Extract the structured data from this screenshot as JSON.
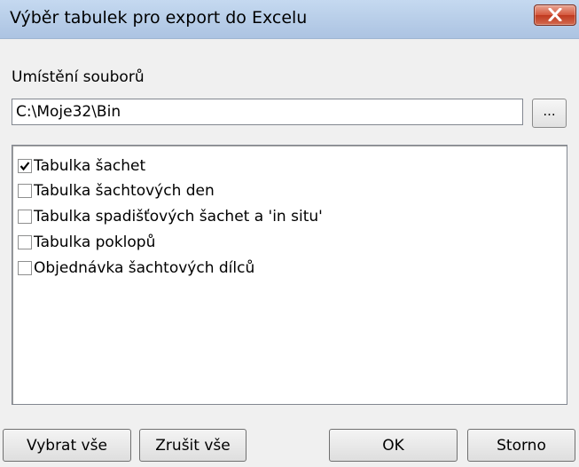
{
  "window": {
    "title": "Výběr tabulek pro export do Excelu"
  },
  "location": {
    "label": "Umístění souborů",
    "path_value": "C:\\Moje32\\Bin",
    "browse_label": "..."
  },
  "tables": {
    "items": [
      {
        "label": "Tabulka šachet",
        "checked": true
      },
      {
        "label": "Tabulka šachtových den",
        "checked": false
      },
      {
        "label": "Tabulka spadišťových šachet a 'in situ'",
        "checked": false
      },
      {
        "label": "Tabulka poklopů",
        "checked": false
      },
      {
        "label": "Objednávka šachtových dílců",
        "checked": false
      }
    ]
  },
  "buttons": {
    "select_all": "Vybrat vše",
    "clear_all": "Zrušit vše",
    "ok": "OK",
    "cancel": "Storno"
  },
  "icons": {
    "close": "close-icon",
    "checkmark": "checkmark-icon"
  },
  "colors": {
    "titlebar": "#b7cde8",
    "close_button": "#c0391f",
    "background": "#f0f0f0"
  }
}
